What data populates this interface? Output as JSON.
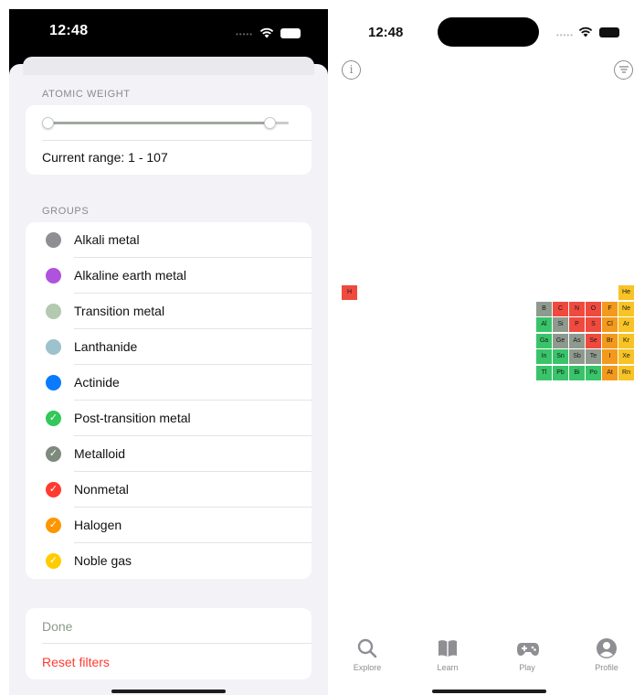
{
  "left_screen": {
    "status_time": "12:48",
    "atomic_weight": {
      "section_label": "ATOMIC WEIGHT",
      "current_range": "Current range: 1 - 107",
      "slider_low_fraction": 0.0,
      "slider_high_fraction": 0.92
    },
    "groups_label": "GROUPS",
    "groups": [
      {
        "label": "Alkali metal",
        "color": "#8e8e93",
        "checked": false
      },
      {
        "label": "Alkaline earth metal",
        "color": "#af52de",
        "checked": false
      },
      {
        "label": "Transition metal",
        "color": "#b3c9b0",
        "checked": false
      },
      {
        "label": "Lanthanide",
        "color": "#9cc2cc",
        "checked": false
      },
      {
        "label": "Actinide",
        "color": "#0a7aff",
        "checked": false
      },
      {
        "label": "Post-transition metal",
        "color": "#34c759",
        "checked": true
      },
      {
        "label": "Metalloid",
        "color": "#7d8a7d",
        "checked": true
      },
      {
        "label": "Nonmetal",
        "color": "#ff3b30",
        "checked": true
      },
      {
        "label": "Halogen",
        "color": "#ff9500",
        "checked": true
      },
      {
        "label": "Noble gas",
        "color": "#ffcc00",
        "checked": true
      }
    ],
    "done_label": "Done",
    "reset_label": "Reset filters",
    "done_color": "#8a9a8a",
    "reset_color": "#ff3b30"
  },
  "right_screen": {
    "status_time": "12:48",
    "info_icon": "info-circle-icon",
    "filter_icon": "filter-lines-icon",
    "elements": [
      {
        "symbol": "H",
        "group": "nonmetal",
        "row": 1,
        "col": 1
      },
      {
        "symbol": "He",
        "group": "noble",
        "row": 1,
        "col": 18
      },
      {
        "symbol": "B",
        "group": "metalloid",
        "row": 2,
        "col": 13
      },
      {
        "symbol": "C",
        "group": "nonmetal",
        "row": 2,
        "col": 14
      },
      {
        "symbol": "N",
        "group": "nonmetal",
        "row": 2,
        "col": 15
      },
      {
        "symbol": "O",
        "group": "nonmetal",
        "row": 2,
        "col": 16
      },
      {
        "symbol": "F",
        "group": "halogen",
        "row": 2,
        "col": 17
      },
      {
        "symbol": "Ne",
        "group": "noble",
        "row": 2,
        "col": 18
      },
      {
        "symbol": "Al",
        "group": "post",
        "row": 3,
        "col": 13
      },
      {
        "symbol": "Si",
        "group": "metalloid",
        "row": 3,
        "col": 14
      },
      {
        "symbol": "P",
        "group": "nonmetal",
        "row": 3,
        "col": 15
      },
      {
        "symbol": "S",
        "group": "nonmetal",
        "row": 3,
        "col": 16
      },
      {
        "symbol": "Cl",
        "group": "halogen",
        "row": 3,
        "col": 17
      },
      {
        "symbol": "Ar",
        "group": "noble",
        "row": 3,
        "col": 18
      },
      {
        "symbol": "Ga",
        "group": "post",
        "row": 4,
        "col": 13
      },
      {
        "symbol": "Ge",
        "group": "metalloid",
        "row": 4,
        "col": 14
      },
      {
        "symbol": "As",
        "group": "metalloid",
        "row": 4,
        "col": 15
      },
      {
        "symbol": "Se",
        "group": "nonmetal",
        "row": 4,
        "col": 16
      },
      {
        "symbol": "Br",
        "group": "halogen",
        "row": 4,
        "col": 17
      },
      {
        "symbol": "Kr",
        "group": "noble",
        "row": 4,
        "col": 18
      },
      {
        "symbol": "In",
        "group": "post",
        "row": 5,
        "col": 13
      },
      {
        "symbol": "Sn",
        "group": "post",
        "row": 5,
        "col": 14
      },
      {
        "symbol": "Sb",
        "group": "metalloid",
        "row": 5,
        "col": 15
      },
      {
        "symbol": "Te",
        "group": "metalloid",
        "row": 5,
        "col": 16
      },
      {
        "symbol": "I",
        "group": "halogen",
        "row": 5,
        "col": 17
      },
      {
        "symbol": "Xe",
        "group": "noble",
        "row": 5,
        "col": 18
      },
      {
        "symbol": "Tl",
        "group": "post",
        "row": 6,
        "col": 13
      },
      {
        "symbol": "Pb",
        "group": "post",
        "row": 6,
        "col": 14
      },
      {
        "symbol": "Bi",
        "group": "post",
        "row": 6,
        "col": 15
      },
      {
        "symbol": "Po",
        "group": "post",
        "row": 6,
        "col": 16
      },
      {
        "symbol": "At",
        "group": "halogen",
        "row": 6,
        "col": 17
      },
      {
        "symbol": "Rn",
        "group": "noble",
        "row": 6,
        "col": 18
      }
    ],
    "group_colors": {
      "nonmetal": "#f04a3e",
      "noble": "#f7c325",
      "metalloid": "#8f9a8e",
      "halogen": "#f39a1c",
      "post": "#39c46a"
    },
    "tabs": [
      {
        "label": "Explore",
        "icon": "magnifier-icon"
      },
      {
        "label": "Learn",
        "icon": "book-icon"
      },
      {
        "label": "Play",
        "icon": "gamepad-icon"
      },
      {
        "label": "Profile",
        "icon": "person-circle-icon"
      }
    ]
  }
}
